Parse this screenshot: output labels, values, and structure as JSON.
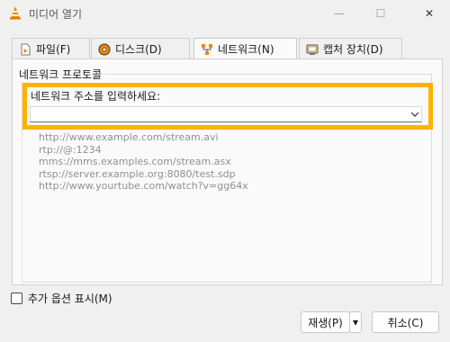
{
  "window": {
    "title": "미디어 열기",
    "min_glyph": "—",
    "max_glyph": "☐",
    "close_glyph": "✕"
  },
  "tabs": [
    {
      "label": "파일(F)",
      "icon": "file-play-icon"
    },
    {
      "label": "디스크(D)",
      "icon": "disc-icon"
    },
    {
      "label": "네트워크(N)",
      "icon": "network-icon",
      "active": true
    },
    {
      "label": "캡처 장치(D)",
      "icon": "capture-device-icon"
    }
  ],
  "network": {
    "group_title": "네트워크 프로토콜",
    "url_label": "네트워크 주소를 입력하세요:",
    "url_value": "",
    "examples": [
      "http://www.example.com/stream.avi",
      "rtp://@:1234",
      "mms://mms.examples.com/stream.asx",
      "rtsp://server.example.org:8080/test.sdp",
      "http://www.yourtube.com/watch?v=gg64x"
    ]
  },
  "footer": {
    "more_options": "추가 옵션 표시(M)",
    "play": "재생(P)",
    "play_dropdown": "▾",
    "cancel": "취소(C)"
  },
  "colors": {
    "highlight": "#ffb300",
    "accent_orange": "#f08a00"
  }
}
